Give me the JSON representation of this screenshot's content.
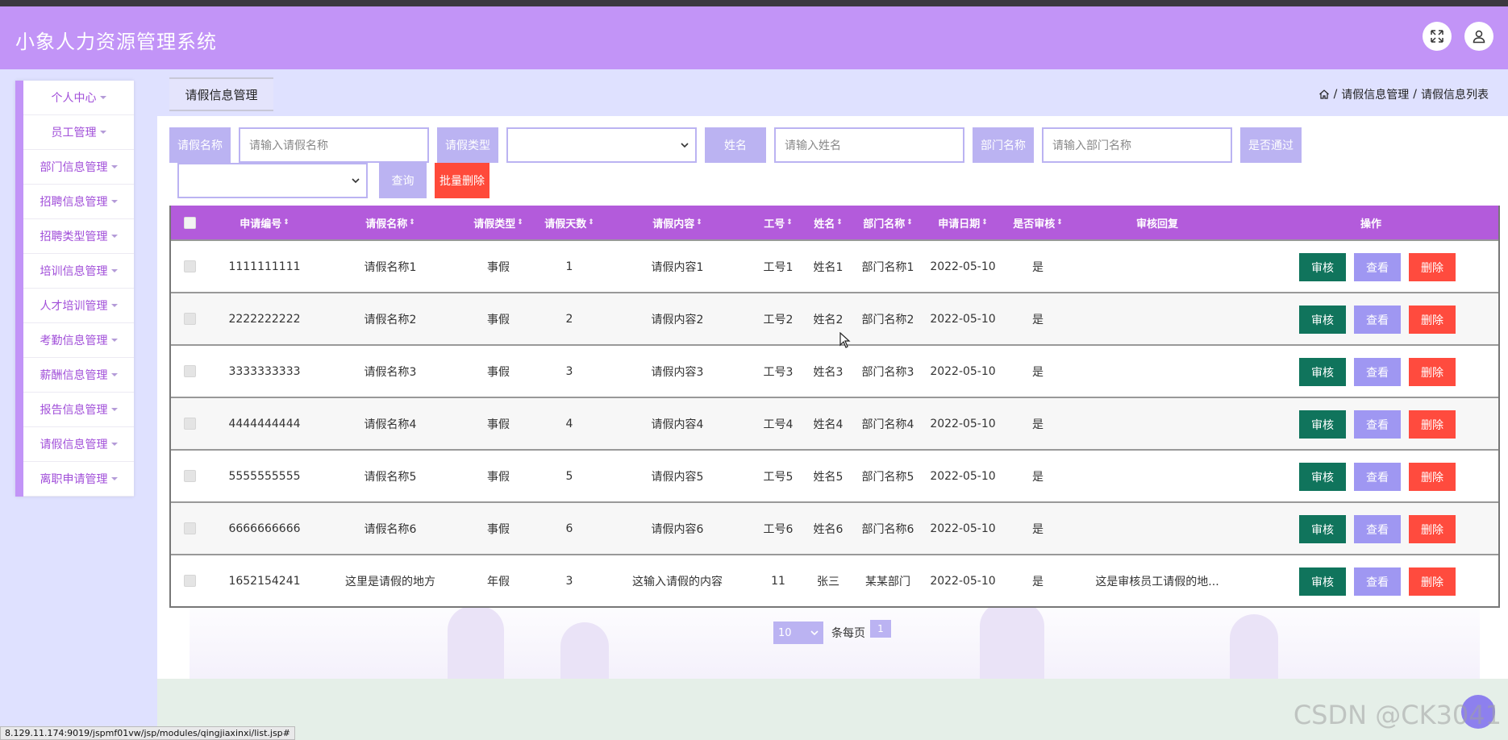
{
  "app": {
    "title": "小象人力资源管理系统"
  },
  "sidebar": {
    "items": [
      {
        "label": "个人中心"
      },
      {
        "label": "员工管理"
      },
      {
        "label": "部门信息管理"
      },
      {
        "label": "招聘信息管理"
      },
      {
        "label": "招聘类型管理"
      },
      {
        "label": "培训信息管理"
      },
      {
        "label": "人才培训管理"
      },
      {
        "label": "考勤信息管理"
      },
      {
        "label": "薪酬信息管理"
      },
      {
        "label": "报告信息管理"
      },
      {
        "label": "请假信息管理"
      },
      {
        "label": "离职申请管理"
      }
    ]
  },
  "tab": {
    "label": "请假信息管理"
  },
  "breadcrumb": {
    "level1": "请假信息管理",
    "level2": "请假信息列表",
    "sep": "/"
  },
  "search": {
    "name_label": "请假名称",
    "name_placeholder": "请输入请假名称",
    "type_label": "请假类型",
    "person_label": "姓名",
    "person_placeholder": "请输入姓名",
    "dept_label": "部门名称",
    "dept_placeholder": "请输入部门名称",
    "passed_label": "是否通过",
    "query_button": "查询",
    "batch_delete_button": "批量删除"
  },
  "table": {
    "headers": {
      "id": "申请编号",
      "name": "请假名称",
      "type": "请假类型",
      "days": "请假天数",
      "content": "请假内容",
      "empno": "工号",
      "person": "姓名",
      "dept": "部门名称",
      "date": "申请日期",
      "reviewed": "是否审核",
      "reply": "审核回复",
      "actions": "操作"
    },
    "action_labels": {
      "review": "审核",
      "view": "查看",
      "delete": "删除"
    },
    "rows": [
      {
        "id": "1111111111",
        "name": "请假名称1",
        "type": "事假",
        "days": "1",
        "content": "请假内容1",
        "empno": "工号1",
        "person": "姓名1",
        "dept": "部门名称1",
        "date": "2022-05-10",
        "reviewed": "是",
        "reply": ""
      },
      {
        "id": "2222222222",
        "name": "请假名称2",
        "type": "事假",
        "days": "2",
        "content": "请假内容2",
        "empno": "工号2",
        "person": "姓名2",
        "dept": "部门名称2",
        "date": "2022-05-10",
        "reviewed": "是",
        "reply": ""
      },
      {
        "id": "3333333333",
        "name": "请假名称3",
        "type": "事假",
        "days": "3",
        "content": "请假内容3",
        "empno": "工号3",
        "person": "姓名3",
        "dept": "部门名称3",
        "date": "2022-05-10",
        "reviewed": "是",
        "reply": ""
      },
      {
        "id": "4444444444",
        "name": "请假名称4",
        "type": "事假",
        "days": "4",
        "content": "请假内容4",
        "empno": "工号4",
        "person": "姓名4",
        "dept": "部门名称4",
        "date": "2022-05-10",
        "reviewed": "是",
        "reply": ""
      },
      {
        "id": "5555555555",
        "name": "请假名称5",
        "type": "事假",
        "days": "5",
        "content": "请假内容5",
        "empno": "工号5",
        "person": "姓名5",
        "dept": "部门名称5",
        "date": "2022-05-10",
        "reviewed": "是",
        "reply": ""
      },
      {
        "id": "6666666666",
        "name": "请假名称6",
        "type": "事假",
        "days": "6",
        "content": "请假内容6",
        "empno": "工号6",
        "person": "姓名6",
        "dept": "部门名称6",
        "date": "2022-05-10",
        "reviewed": "是",
        "reply": ""
      },
      {
        "id": "1652154241",
        "name": "这里是请假的地方",
        "type": "年假",
        "days": "3",
        "content": "这输入请假的内容",
        "empno": "11",
        "person": "张三",
        "dept": "某某部门",
        "date": "2022-05-10",
        "reviewed": "是",
        "reply": "这是审核员工请假的地..."
      }
    ]
  },
  "pager": {
    "page_size": "10",
    "per_page_label": "条每页",
    "current_page": "1"
  },
  "statusbar": {
    "url": "8.129.11.174:9019/jspmf01vw/jsp/modules/qingjiaxinxi/list.jsp#"
  },
  "watermark": {
    "text": "CSDN @CK3041"
  },
  "colors": {
    "header": "#c294f7",
    "table_header": "#b35bdb",
    "accent_light": "#bbb3f2",
    "review": "#10745c",
    "delete": "#ff4b3e"
  }
}
